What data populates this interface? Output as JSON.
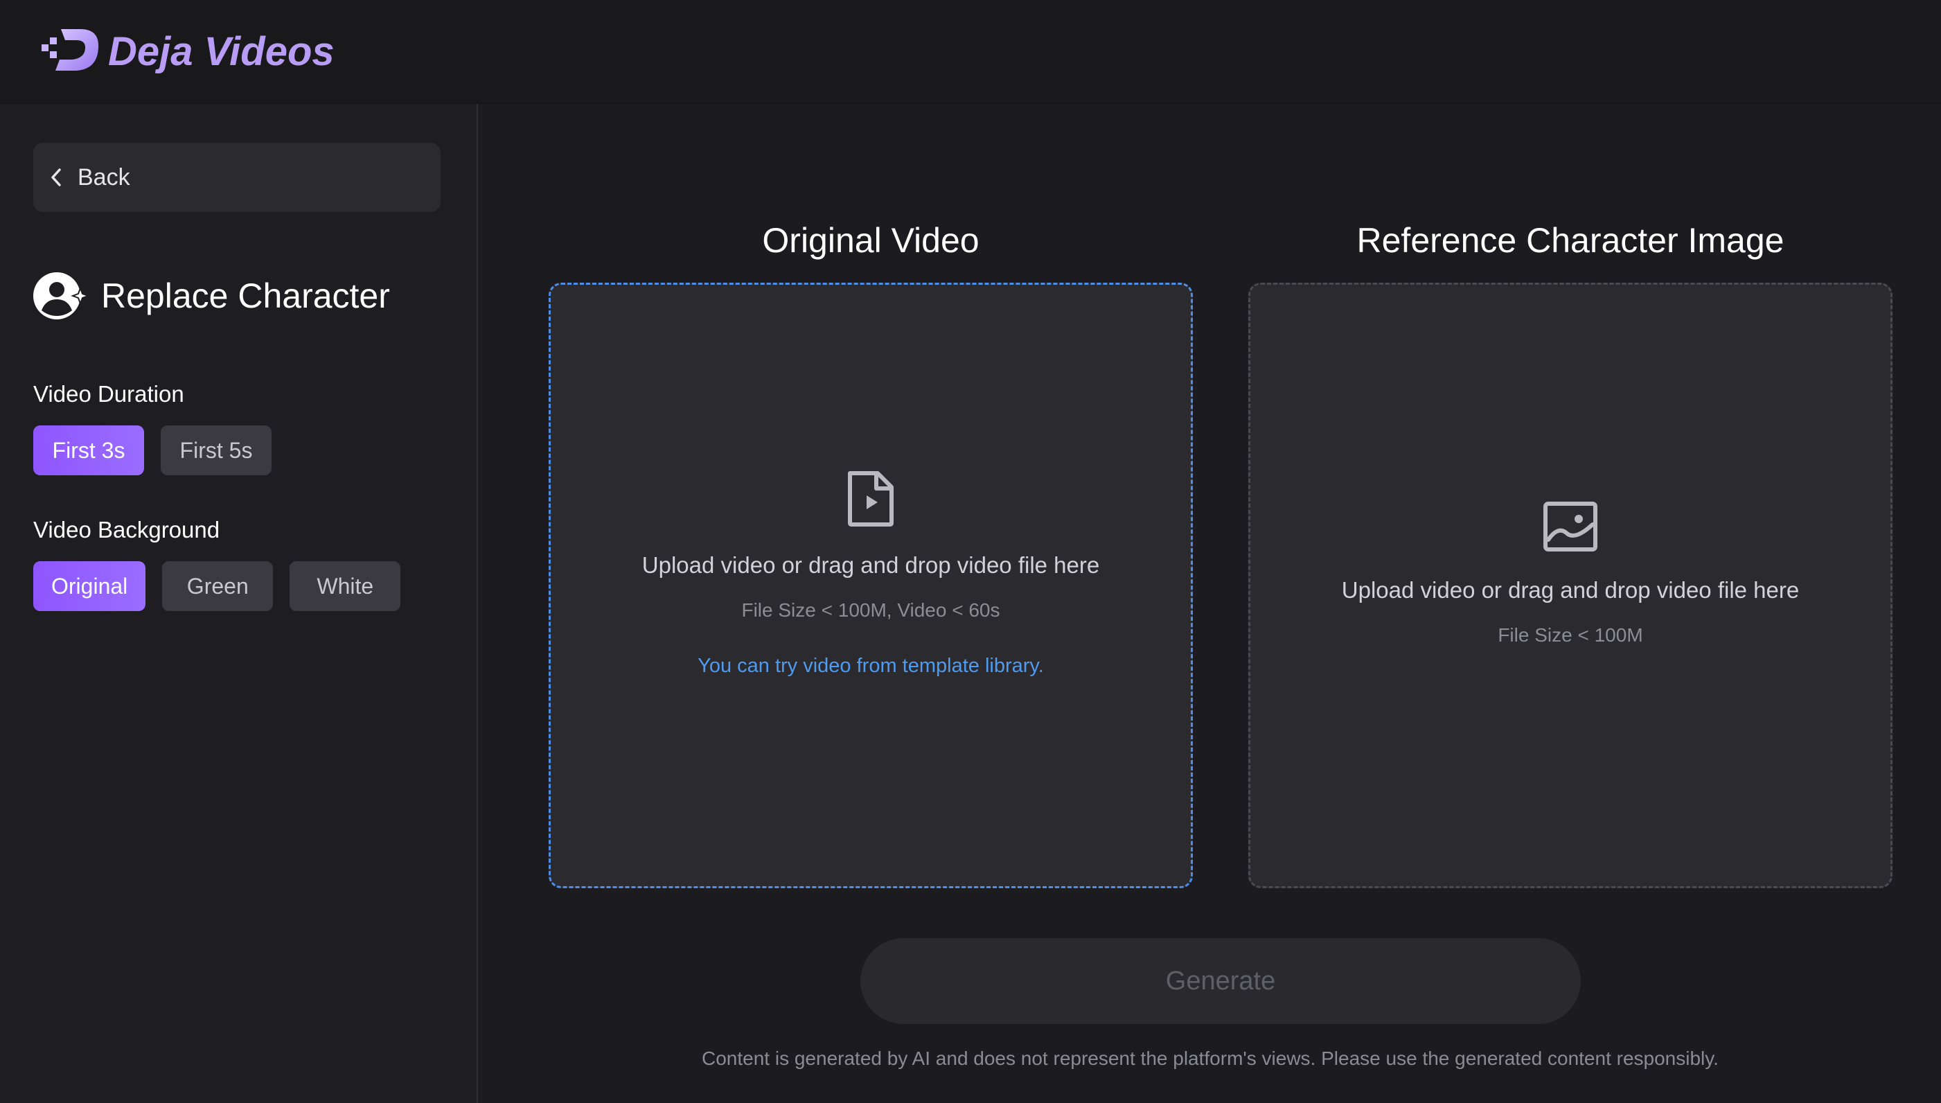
{
  "app": {
    "name": "Deja Videos"
  },
  "sidebar": {
    "back_label": "Back",
    "heading": "Replace Character",
    "video_duration": {
      "label": "Video Duration",
      "options": [
        "First 3s",
        "First 5s"
      ],
      "selected": "First 3s"
    },
    "video_background": {
      "label": "Video Background",
      "options": [
        "Original",
        "Green",
        "White"
      ],
      "selected": "Original"
    }
  },
  "main": {
    "original_video": {
      "title": "Original Video",
      "upload_text": "Upload video or drag and drop video file here",
      "limits": "File Size < 100M, Video < 60s",
      "template_link": "You can try video from template library."
    },
    "reference_image": {
      "title": "Reference Character Image",
      "upload_text": "Upload video or drag and drop video file here",
      "limits": "File Size < 100M"
    },
    "generate_label": "Generate",
    "disclaimer": "Content is generated by AI and does not represent the platform's views. Please use the generated content responsibly."
  },
  "colors": {
    "accent": "#9062ff",
    "link": "#4f9bf0",
    "background": "#1c1c20"
  }
}
